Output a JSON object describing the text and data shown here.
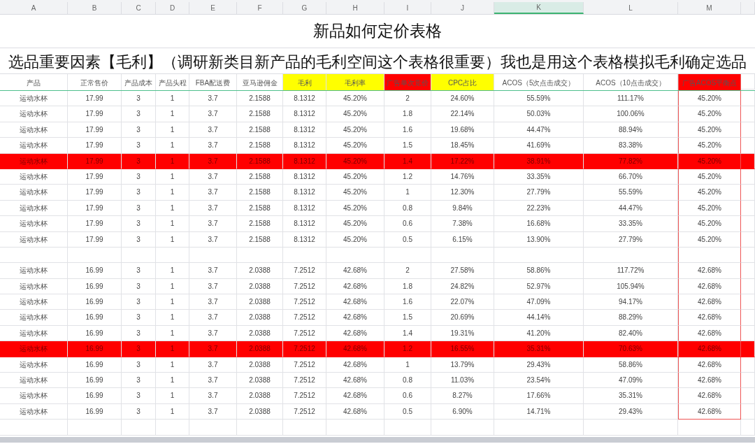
{
  "column_letters": [
    {
      "label": "A",
      "selected": false
    },
    {
      "label": "B",
      "selected": false
    },
    {
      "label": "C",
      "selected": false
    },
    {
      "label": "D",
      "selected": false
    },
    {
      "label": "E",
      "selected": false
    },
    {
      "label": "F",
      "selected": false
    },
    {
      "label": "G",
      "selected": false
    },
    {
      "label": "H",
      "selected": false
    },
    {
      "label": "I",
      "selected": false
    },
    {
      "label": "J",
      "selected": false
    },
    {
      "label": "K",
      "selected": true
    },
    {
      "label": "L",
      "selected": false
    },
    {
      "label": "M",
      "selected": false
    }
  ],
  "title": "新品如何定价表格",
  "subtitle": "选品重要因素【毛利】（调研新类目新产品的毛利空间这个表格很重要）我也是用这个表格模拟毛利确定选品",
  "headers": [
    {
      "label": "产品"
    },
    {
      "label": "正常售价"
    },
    {
      "label": "产品成本"
    },
    {
      "label": "产品头程"
    },
    {
      "label": "FBA配送费"
    },
    {
      "label": "亚马逊佣金"
    },
    {
      "label": "毛利",
      "color": "#ffff00"
    },
    {
      "label": "毛利率",
      "color": "#ffff00"
    },
    {
      "label": "广告单次竞价",
      "color": "#ff0000"
    },
    {
      "label": "CPC占比",
      "color": "#ffff00"
    },
    {
      "label": "ACOS（5次点击成交）"
    },
    {
      "label": "ACOS（10点击成交）"
    },
    {
      "label": "广告ACOS平衡点",
      "color": "#ff0000"
    }
  ],
  "groups": [
    {
      "rows": [
        {
          "highlighted": false,
          "cells": [
            "运动水杯",
            "17.99",
            "3",
            "1",
            "3.7",
            "2.1588",
            "8.1312",
            "45.20%",
            "2",
            "24.60%",
            "55.59%",
            "111.17%",
            "45.20%"
          ]
        },
        {
          "highlighted": false,
          "cells": [
            "运动水杯",
            "17.99",
            "3",
            "1",
            "3.7",
            "2.1588",
            "8.1312",
            "45.20%",
            "1.8",
            "22.14%",
            "50.03%",
            "100.06%",
            "45.20%"
          ]
        },
        {
          "highlighted": false,
          "cells": [
            "运动水杯",
            "17.99",
            "3",
            "1",
            "3.7",
            "2.1588",
            "8.1312",
            "45.20%",
            "1.6",
            "19.68%",
            "44.47%",
            "88.94%",
            "45.20%"
          ]
        },
        {
          "highlighted": false,
          "cells": [
            "运动水杯",
            "17.99",
            "3",
            "1",
            "3.7",
            "2.1588",
            "8.1312",
            "45.20%",
            "1.5",
            "18.45%",
            "41.69%",
            "83.38%",
            "45.20%"
          ]
        },
        {
          "highlighted": true,
          "cells": [
            "运动水杯",
            "17.99",
            "3",
            "1",
            "3.7",
            "2.1588",
            "8.1312",
            "45.20%",
            "1.4",
            "17.22%",
            "38.91%",
            "77.82%",
            "45.20%"
          ]
        },
        {
          "highlighted": false,
          "cells": [
            "运动水杯",
            "17.99",
            "3",
            "1",
            "3.7",
            "2.1588",
            "8.1312",
            "45.20%",
            "1.2",
            "14.76%",
            "33.35%",
            "66.70%",
            "45.20%"
          ]
        },
        {
          "highlighted": false,
          "cells": [
            "运动水杯",
            "17.99",
            "3",
            "1",
            "3.7",
            "2.1588",
            "8.1312",
            "45.20%",
            "1",
            "12.30%",
            "27.79%",
            "55.59%",
            "45.20%"
          ]
        },
        {
          "highlighted": false,
          "cells": [
            "运动水杯",
            "17.99",
            "3",
            "1",
            "3.7",
            "2.1588",
            "8.1312",
            "45.20%",
            "0.8",
            "9.84%",
            "22.23%",
            "44.47%",
            "45.20%"
          ]
        },
        {
          "highlighted": false,
          "cells": [
            "运动水杯",
            "17.99",
            "3",
            "1",
            "3.7",
            "2.1588",
            "8.1312",
            "45.20%",
            "0.6",
            "7.38%",
            "16.68%",
            "33.35%",
            "45.20%"
          ]
        },
        {
          "highlighted": false,
          "cells": [
            "运动水杯",
            "17.99",
            "3",
            "1",
            "3.7",
            "2.1588",
            "8.1312",
            "45.20%",
            "0.5",
            "6.15%",
            "13.90%",
            "27.79%",
            "45.20%"
          ]
        }
      ]
    },
    {
      "rows": [
        {
          "highlighted": false,
          "cells": [
            "运动水杯",
            "16.99",
            "3",
            "1",
            "3.7",
            "2.0388",
            "7.2512",
            "42.68%",
            "2",
            "27.58%",
            "58.86%",
            "117.72%",
            "42.68%"
          ]
        },
        {
          "highlighted": false,
          "cells": [
            "运动水杯",
            "16.99",
            "3",
            "1",
            "3.7",
            "2.0388",
            "7.2512",
            "42.68%",
            "1.8",
            "24.82%",
            "52.97%",
            "105.94%",
            "42.68%"
          ]
        },
        {
          "highlighted": false,
          "cells": [
            "运动水杯",
            "16.99",
            "3",
            "1",
            "3.7",
            "2.0388",
            "7.2512",
            "42.68%",
            "1.6",
            "22.07%",
            "47.09%",
            "94.17%",
            "42.68%"
          ]
        },
        {
          "highlighted": false,
          "cells": [
            "运动水杯",
            "16.99",
            "3",
            "1",
            "3.7",
            "2.0388",
            "7.2512",
            "42.68%",
            "1.5",
            "20.69%",
            "44.14%",
            "88.29%",
            "42.68%"
          ]
        },
        {
          "highlighted": false,
          "cells": [
            "运动水杯",
            "16.99",
            "3",
            "1",
            "3.7",
            "2.0388",
            "7.2512",
            "42.68%",
            "1.4",
            "19.31%",
            "41.20%",
            "82.40%",
            "42.68%"
          ]
        },
        {
          "highlighted": true,
          "cells": [
            "运动水杯",
            "16.99",
            "3",
            "1",
            "3.7",
            "2.0388",
            "7.2512",
            "42.68%",
            "1.2",
            "16.55%",
            "35.31%",
            "70.63%",
            "42.68%"
          ]
        },
        {
          "highlighted": false,
          "cells": [
            "运动水杯",
            "16.99",
            "3",
            "1",
            "3.7",
            "2.0388",
            "7.2512",
            "42.68%",
            "1",
            "13.79%",
            "29.43%",
            "58.86%",
            "42.68%"
          ]
        },
        {
          "highlighted": false,
          "cells": [
            "运动水杯",
            "16.99",
            "3",
            "1",
            "3.7",
            "2.0388",
            "7.2512",
            "42.68%",
            "0.8",
            "11.03%",
            "23.54%",
            "47.09%",
            "42.68%"
          ]
        },
        {
          "highlighted": false,
          "cells": [
            "运动水杯",
            "16.99",
            "3",
            "1",
            "3.7",
            "2.0388",
            "7.2512",
            "42.68%",
            "0.6",
            "8.27%",
            "17.66%",
            "35.31%",
            "42.68%"
          ]
        },
        {
          "highlighted": false,
          "cells": [
            "运动水杯",
            "16.99",
            "3",
            "1",
            "3.7",
            "2.0388",
            "7.2512",
            "42.68%",
            "0.5",
            "6.90%",
            "14.71%",
            "29.43%",
            "42.68%"
          ]
        }
      ]
    }
  ]
}
